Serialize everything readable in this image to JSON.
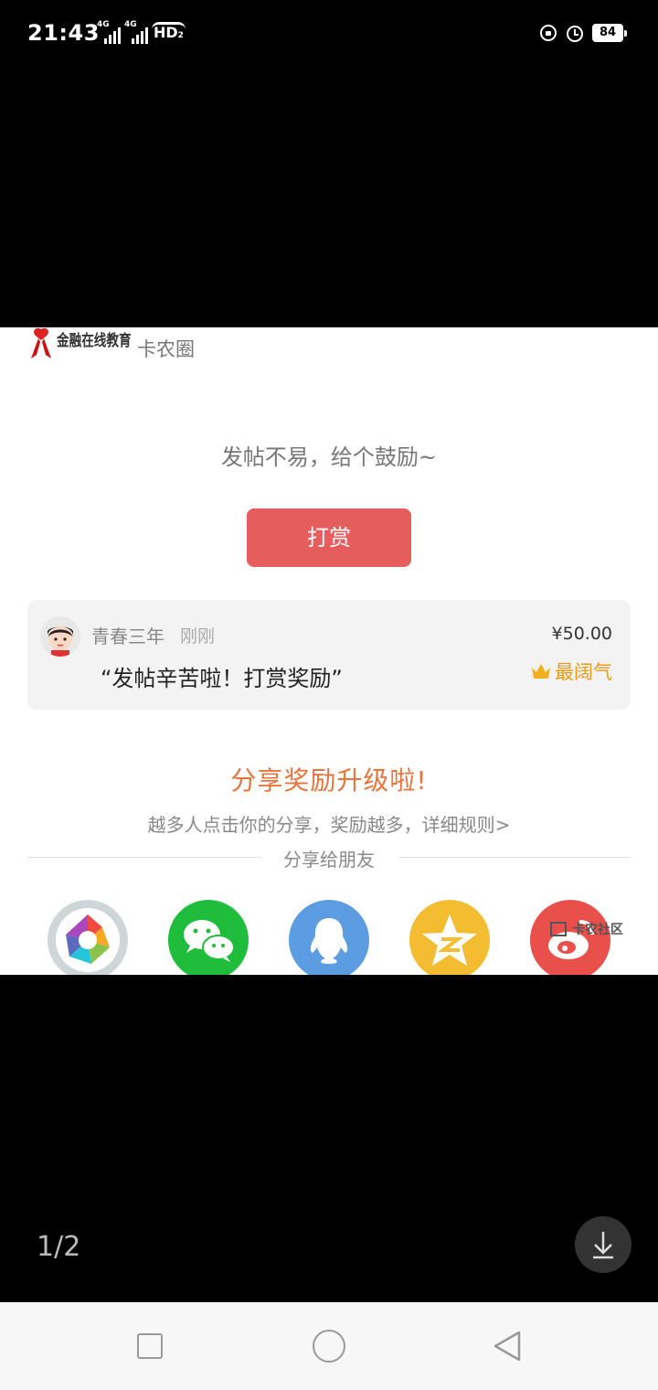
{
  "status_bar": {
    "time": "21:43",
    "network_1": "4G",
    "network_2": "4G",
    "hd_label": "HD",
    "hd_sub": "2",
    "battery": "84"
  },
  "content": {
    "logo_text": "金融在线教育",
    "community_name": "卡农圈",
    "reward_prompt": "发帖不易，给个鼓励~",
    "reward_button": "打赏",
    "tip": {
      "user": "青春三年",
      "time": "刚刚",
      "amount": "¥50.00",
      "message": "“发帖辛苦啦！打赏奖励”",
      "badge": "最阔气"
    },
    "share_title": "分享奖励升级啦!",
    "share_subtitle": "越多人点击你的分享，奖励越多，详细规则>",
    "share_label": "分享给朋友",
    "watermark": "卡农社区"
  },
  "viewer": {
    "page_counter": "1/2"
  },
  "colors": {
    "reward_button": "#e65d5d",
    "share_title": "#e8743b",
    "badge": "#e69a1a",
    "wechat": "#1fbd3b",
    "qq": "#5b9de0",
    "qzone": "#f4bd31",
    "weibo": "#e9504c"
  },
  "icons": {
    "share_targets": [
      "moments-icon",
      "wechat-icon",
      "qq-icon",
      "qzone-icon",
      "weibo-icon"
    ],
    "viewer_action": "download-icon",
    "nav": [
      "recents-icon",
      "home-icon",
      "back-icon"
    ]
  }
}
